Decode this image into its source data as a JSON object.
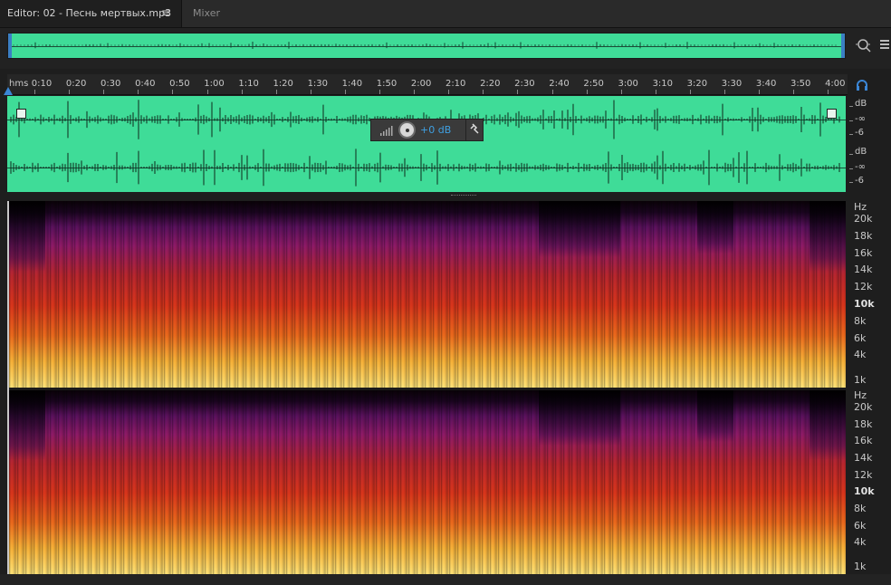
{
  "tabs": {
    "editor_label": "Editor: 02 - Песнь мертвых.mp3",
    "menu_glyph": "≡",
    "mixer_label": "Mixer"
  },
  "ruler": {
    "unit_label": "hms",
    "ticks": [
      "0:10",
      "0:20",
      "0:30",
      "0:40",
      "0:50",
      "1:00",
      "1:10",
      "1:20",
      "1:30",
      "1:40",
      "1:50",
      "2:00",
      "2:10",
      "2:20",
      "2:30",
      "2:40",
      "2:50",
      "3:00",
      "3:10",
      "3:20",
      "3:30",
      "3:40",
      "3:50",
      "4:00"
    ]
  },
  "hud": {
    "value": "+0 dB",
    "pin_glyph": "📌"
  },
  "db_scale": {
    "channel1": [
      "dB",
      "-∞",
      "-6"
    ],
    "channel2": [
      "dB",
      "-∞",
      "-6"
    ]
  },
  "hz_scale": {
    "unit": "Hz",
    "labels": [
      "20k",
      "18k",
      "16k",
      "14k",
      "12k",
      "10k",
      "8k",
      "6k",
      "4k",
      "1k"
    ]
  },
  "colors": {
    "waveform": "#3fdc98",
    "accent": "#3b86d6",
    "hud_value": "#3f9fe0"
  },
  "icons": {
    "zoom": "zoom-icon",
    "list": "list-icon",
    "headphone": "headphone-icon"
  }
}
